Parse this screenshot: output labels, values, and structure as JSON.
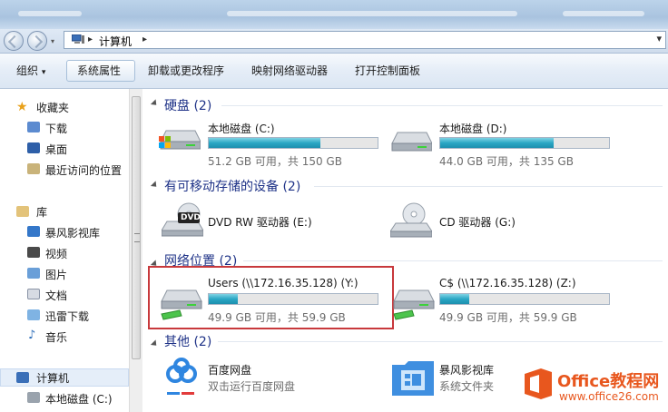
{
  "address": {
    "path": "计算机",
    "sep1": "▸",
    "sep2": "▸",
    "dropdown": "▾"
  },
  "toolbar": {
    "organize": "组织",
    "organize_arrow": "▾",
    "system_properties": "系统属性",
    "uninstall": "卸载或更改程序",
    "map_drive": "映射网络驱动器",
    "control_panel": "打开控制面板"
  },
  "sidebar": {
    "favorites": "收藏夹",
    "downloads": "下载",
    "desktop": "桌面",
    "recent": "最近访问的位置",
    "libraries": "库",
    "storm_lib": "暴风影视库",
    "videos": "视频",
    "pictures": "图片",
    "documents": "文档",
    "thunder": "迅雷下载",
    "music": "音乐",
    "computer": "计算机",
    "local_c": "本地磁盘 (C:)"
  },
  "groups": {
    "hdd": "硬盘 (2)",
    "removable": "有可移动存储的设备 (2)",
    "network": "网络位置 (2)",
    "other": "其他 (2)"
  },
  "drives": {
    "c": {
      "name": "本地磁盘 (C:)",
      "info": "51.2 GB 可用，共 150 GB",
      "used_fraction": 0.66
    },
    "d": {
      "name": "本地磁盘 (D:)",
      "info": "44.0 GB 可用，共 135 GB",
      "used_fraction": 0.67
    },
    "e": {
      "name": "DVD RW 驱动器 (E:)",
      "badge": "DVD"
    },
    "g": {
      "name": "CD 驱动器 (G:)"
    },
    "y": {
      "name": "Users (\\\\172.16.35.128) (Y:)",
      "info": "49.9 GB 可用，共 59.9 GB",
      "used_fraction": 0.17
    },
    "z": {
      "name": "C$ (\\\\172.16.35.128) (Z:)",
      "info": "49.9 GB 可用，共 59.9 GB",
      "used_fraction": 0.17
    }
  },
  "other": {
    "baidu": {
      "name": "百度网盘",
      "desc": "双击运行百度网盘"
    },
    "storm": {
      "name": "暴风影视库",
      "desc": "系统文件夹"
    }
  },
  "watermark": {
    "brand": "Office教程网",
    "url": "www.office26.com"
  },
  "colors": {
    "accent_bar": "#2aa7c5",
    "highlight_box": "#c8393c",
    "group_title": "#1e3287",
    "watermark_orange": "#e8571e"
  }
}
